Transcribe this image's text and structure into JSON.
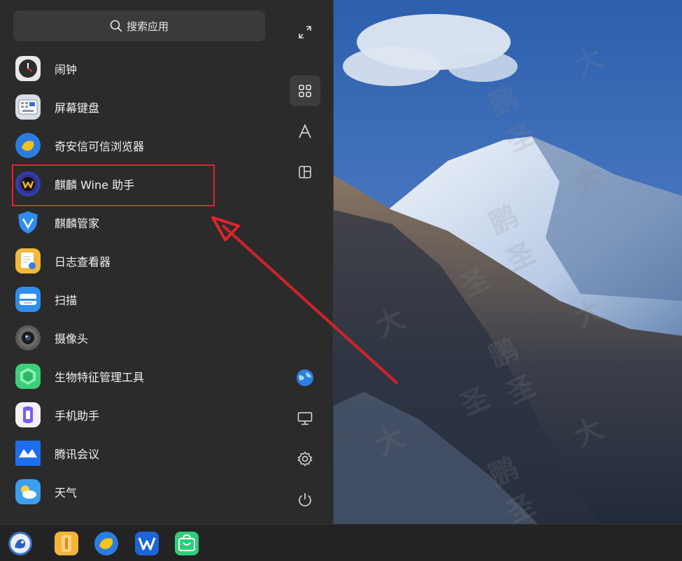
{
  "search": {
    "label": "搜索应用",
    "icon": "search-icon"
  },
  "apps": [
    {
      "label": "闹钟",
      "icon": "alarm-clock-icon"
    },
    {
      "label": "屏幕键盘",
      "icon": "keyboard-icon"
    },
    {
      "label": "奇安信可信浏览器",
      "icon": "qianxin-browser-icon"
    },
    {
      "label": "麒麟 Wine 助手",
      "icon": "kylin-wine-icon"
    },
    {
      "label": "麒麟管家",
      "icon": "kylin-manager-icon"
    },
    {
      "label": "日志查看器",
      "icon": "log-viewer-icon"
    },
    {
      "label": "扫描",
      "icon": "scanner-icon"
    },
    {
      "label": "摄像头",
      "icon": "camera-icon"
    },
    {
      "label": "生物特征管理工具",
      "icon": "biometric-icon"
    },
    {
      "label": "手机助手",
      "icon": "phone-assistant-icon"
    },
    {
      "label": "腾讯会议",
      "icon": "tencent-meeting-icon"
    },
    {
      "label": "天气",
      "icon": "weather-icon"
    }
  ],
  "rail": {
    "top": [
      "expand-icon",
      "all-apps-icon",
      "letter-sort-icon",
      "category-icon"
    ],
    "bottom": [
      "network-globe-icon",
      "computer-icon",
      "settings-gear-icon",
      "power-icon"
    ]
  },
  "taskbar": [
    "start-menu-icon",
    "file-manager-icon",
    "qianxin-browser-icon",
    "wps-icon",
    "app-store-icon"
  ],
  "watermark": "鹏 大 圣",
  "colors": {
    "highlight": "#e0242b",
    "annotation_arrow": "#e0242b"
  }
}
